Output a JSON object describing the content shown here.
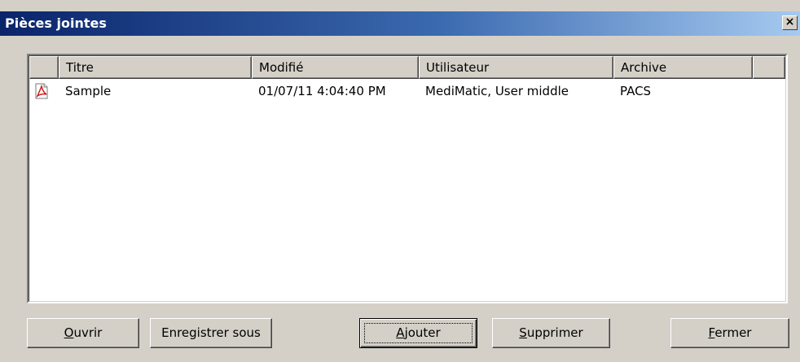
{
  "window": {
    "title": "Pièces jointes",
    "close_label": "×"
  },
  "columns": [
    "",
    "Titre",
    "Modifié",
    "Utilisateur",
    "Archive",
    ""
  ],
  "rows": [
    {
      "icon": "pdf-icon",
      "title": "Sample",
      "modified": "01/07/11 4:04:40 PM",
      "user": "MediMatic, User middle",
      "archive": "PACS"
    }
  ],
  "buttons": {
    "open": {
      "accel": "O",
      "rest": "uvrir"
    },
    "save_as": {
      "label": "Enregistrer sous"
    },
    "add": {
      "accel": "A",
      "rest": "jouter"
    },
    "delete": {
      "accel": "S",
      "rest": "upprimer"
    },
    "close": {
      "accel": "F",
      "rest": "ermer"
    }
  },
  "colors": {
    "titlebar_start": "#0a246a",
    "titlebar_end": "#a6caf0",
    "face": "#d4d0c8"
  }
}
